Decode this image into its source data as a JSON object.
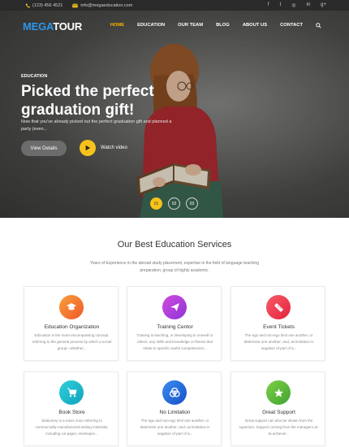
{
  "topbar": {
    "phone": "(123) 456 4521",
    "email": "info@megaeducation.com",
    "social_icons": [
      "facebook-icon",
      "twitter-icon",
      "instagram-icon",
      "linkedin-icon",
      "google-plus-icon"
    ]
  },
  "nav": {
    "logo_part1": "MEGA",
    "logo_part2": "TOUR",
    "items": [
      "HOME",
      "EDUCATION",
      "OUR TEAM",
      "BLOG",
      "ABOUT US",
      "CONTACT"
    ],
    "active_index": 0
  },
  "hero": {
    "eyebrow": "EDUCATION",
    "title": "Picked the perfect graduation gift!",
    "description": "Now that you've already picked out the perfect graduation gift and planned a party (even...",
    "view_button": "View Details",
    "watch_label": "Watch video",
    "slides": [
      "01",
      "02",
      "03"
    ],
    "active_slide": 0
  },
  "services": {
    "title": "Our Best Education Services",
    "subtitle": "Years of Experience in the abroad study placement, expertise in the field of language teaching preparation, group of highly academic.",
    "cards": [
      {
        "title": "Education Organization",
        "text": "Education is the more encompassing concept, referring to the general process by which a social group—whether...",
        "color": "#f5772a",
        "icon": "graduation-cap-icon"
      },
      {
        "title": "Training Centor",
        "text": "Training is teaching, or developing in oneself or others, any skills and knowledge or fitness that relate to specific useful competencies...",
        "color": "#b43fd9",
        "icon": "paper-plane-icon"
      },
      {
        "title": "Event Tickets",
        "text": "The ego and non-ego limit one another, or determine one another; and, as limitation is negation of part of a...",
        "color": "#ef3a4b",
        "icon": "ticket-icon"
      },
      {
        "title": "Book Store",
        "text": "Stationery is a mass noun referring to commercially manufactured writing materials, including cut paper, envelopes...",
        "color": "#19b6c8",
        "icon": "shopping-cart-icon"
      },
      {
        "title": "No Limitation",
        "text": "The ego and non-ego limit one another, or determine one another; and, as limitation is negation of part of a...",
        "color": "#1f6fd8",
        "icon": "coins-icon"
      },
      {
        "title": "Great Support",
        "text": "Great support can also be shown from the superiors. Support coming from the managers at-ta achiever...",
        "color": "#5fb83a",
        "icon": "star-icon"
      }
    ]
  }
}
